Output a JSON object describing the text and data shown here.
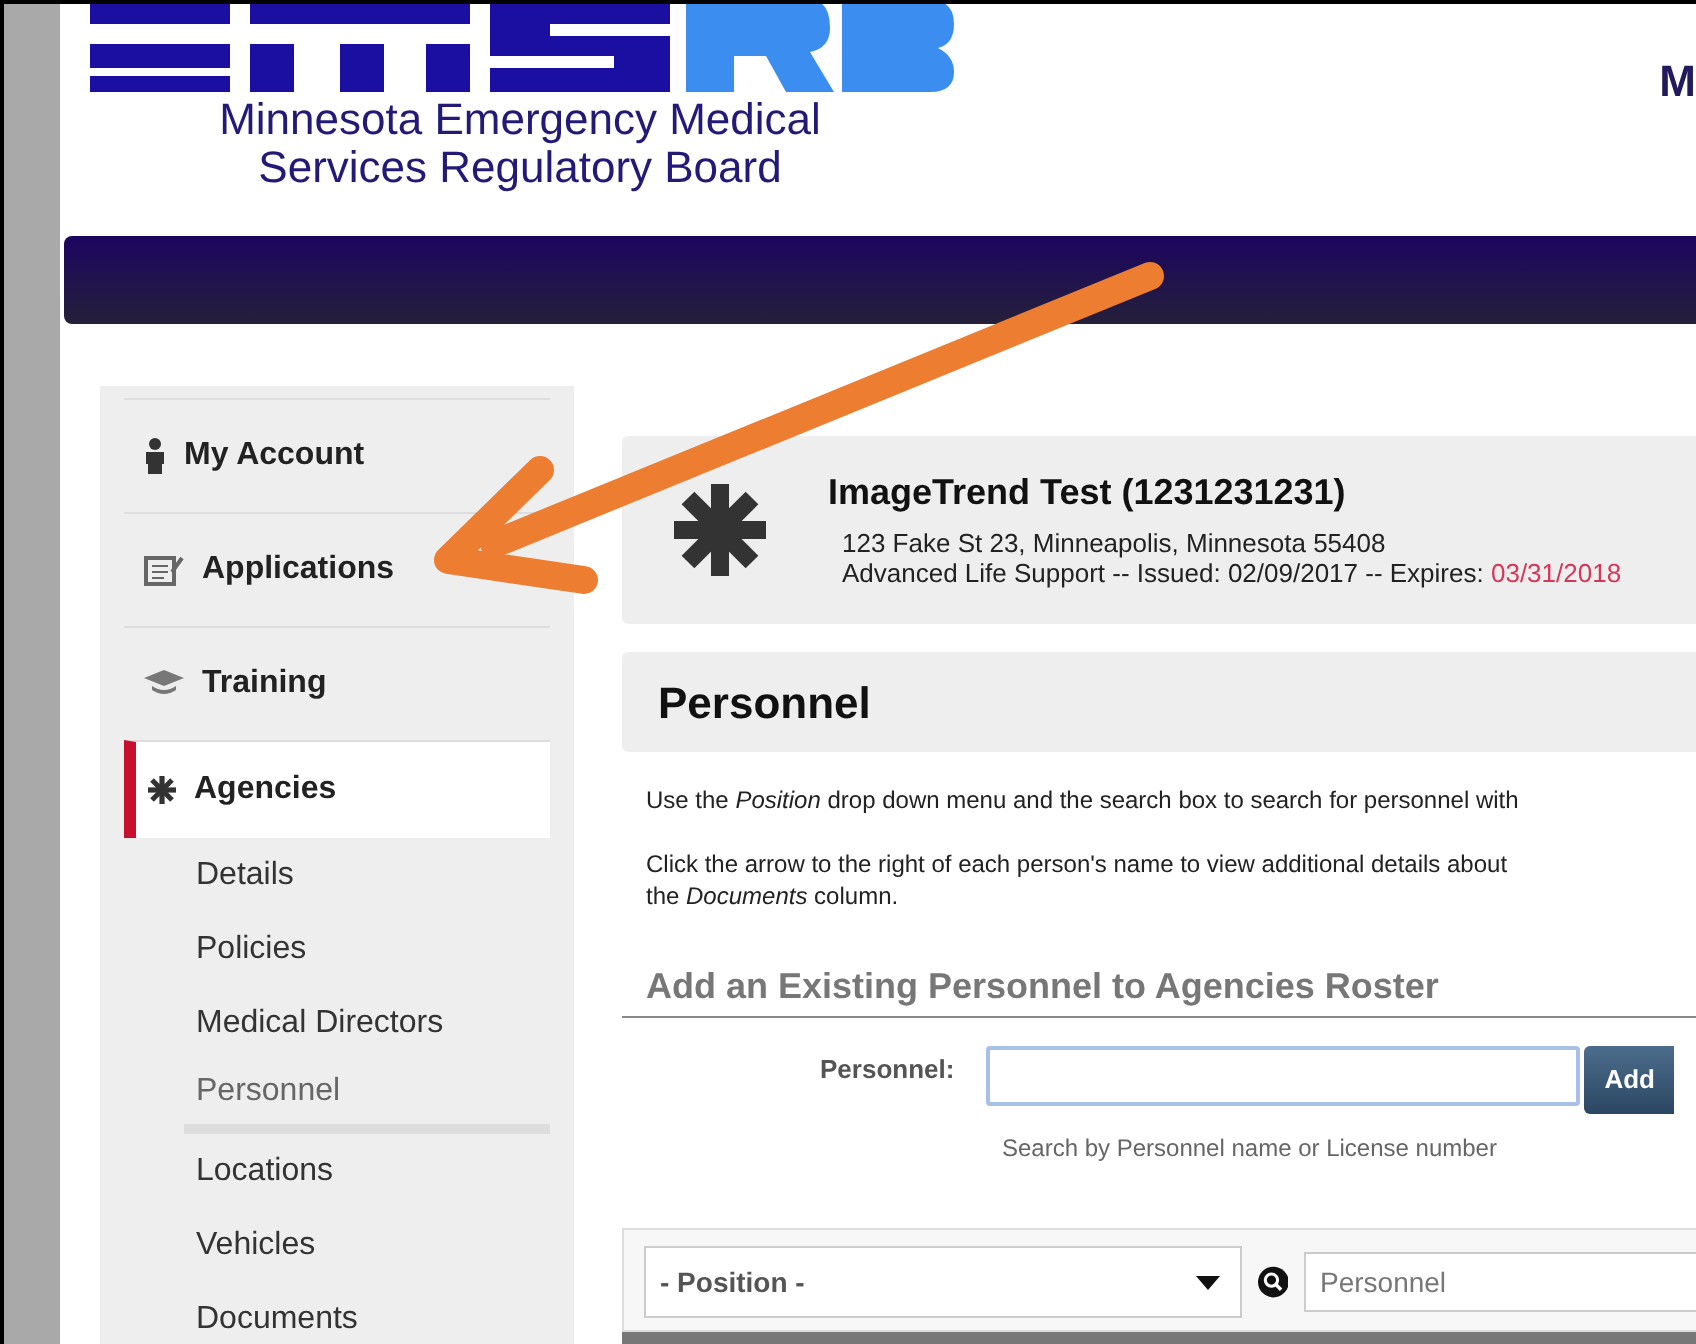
{
  "header": {
    "org_line_1": "Minnesota Emergency Medical",
    "org_line_2": "Services Regulatory Board",
    "top_right_text": "M"
  },
  "sidebar": {
    "items": [
      {
        "label": "My Account",
        "kind": "main",
        "selected": false
      },
      {
        "label": "Applications",
        "kind": "main",
        "selected": false
      },
      {
        "label": "Training",
        "kind": "main",
        "selected": false
      },
      {
        "label": "Agencies",
        "kind": "main",
        "selected": true
      },
      {
        "label": "Details",
        "kind": "sub",
        "selected": false
      },
      {
        "label": "Policies",
        "kind": "sub",
        "selected": false
      },
      {
        "label": "Medical Directors",
        "kind": "sub",
        "selected": false
      },
      {
        "label": "Personnel",
        "kind": "sub",
        "selected": true
      },
      {
        "label": "Locations",
        "kind": "sub",
        "selected": false
      },
      {
        "label": "Vehicles",
        "kind": "sub",
        "selected": false
      },
      {
        "label": "Documents",
        "kind": "sub",
        "selected": false
      }
    ]
  },
  "license": {
    "title": "ImageTrend Test (1231231231)",
    "address": "123 Fake St 23, Minneapolis, Minnesota 55408",
    "status": "Advanced Life Support -- Issued: 02/09/2017 -- Expires:",
    "expires": "03/31/2018"
  },
  "page_title": "Personnel",
  "instructions": [
    "Use the *Position* drop down menu and the search box to search for personnel with",
    "Click the arrow to the right of each person's name to view additional details about",
    "the *Documents* column."
  ],
  "add_section": {
    "heading": "Add an Existing Personnel to Agencies Roster",
    "label": "Personnel:",
    "help": "Search by Personnel name or License number",
    "button": "Add"
  },
  "filter": {
    "position": "- Position -",
    "search_placeholder": "Personnel"
  }
}
